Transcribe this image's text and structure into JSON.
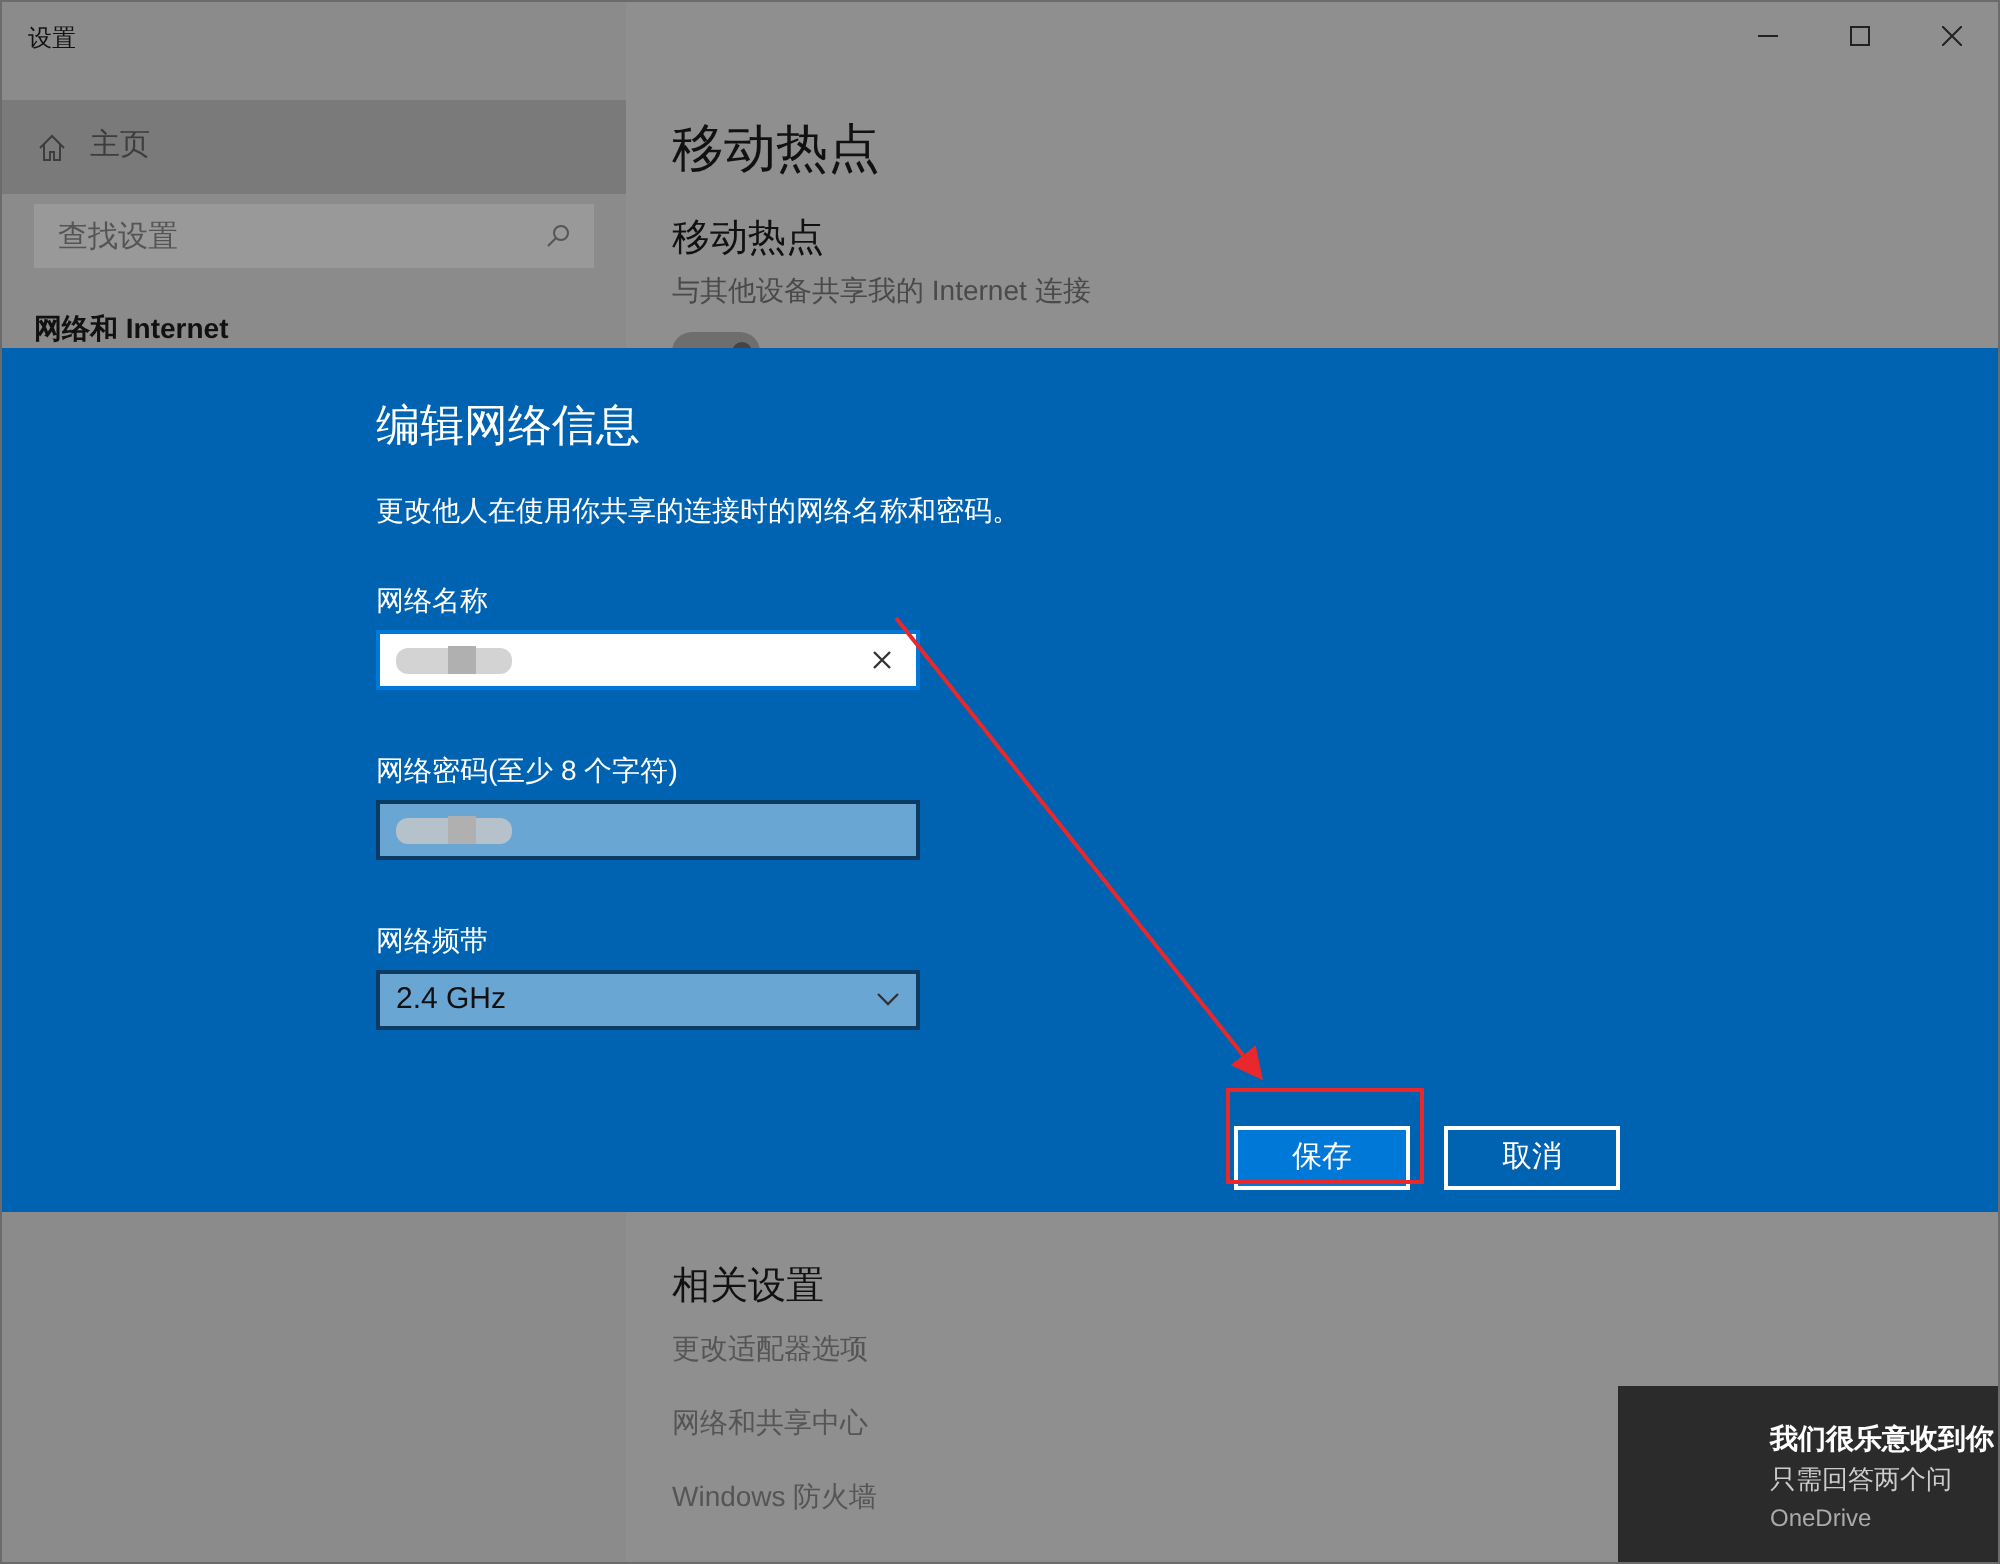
{
  "window": {
    "title": "设置"
  },
  "sidebar": {
    "items": [
      {
        "kind": "home",
        "label": "主页",
        "selected": true
      }
    ],
    "search": {
      "placeholder": "查找设置"
    },
    "section": "网络和 Internet"
  },
  "page": {
    "title": "移动热点",
    "section": {
      "title": "移动热点",
      "description": "与其他设备共享我的 Internet 连接",
      "toggle": {
        "on": true
      }
    },
    "related": {
      "title": "相关设置",
      "links": [
        "更改适配器选项",
        "网络和共享中心",
        "Windows 防火墙"
      ]
    }
  },
  "dialog": {
    "title": "编辑网络信息",
    "description": "更改他人在使用你共享的连接时的网络名称和密码。",
    "fields": [
      {
        "kind": "text",
        "label": "网络名称",
        "focused": true
      },
      {
        "kind": "password",
        "label": "网络密码(至少 8 个字符)",
        "focused": false
      },
      {
        "kind": "select",
        "label": "网络频带",
        "value": "2.4 GHz",
        "focused": false
      }
    ],
    "buttons": [
      {
        "label": "保存",
        "primary": true
      },
      {
        "label": "取消",
        "primary": false
      }
    ]
  },
  "notification": {
    "title": "我们很乐意收到你",
    "body": "只需回答两个问",
    "app": "OneDrive"
  }
}
